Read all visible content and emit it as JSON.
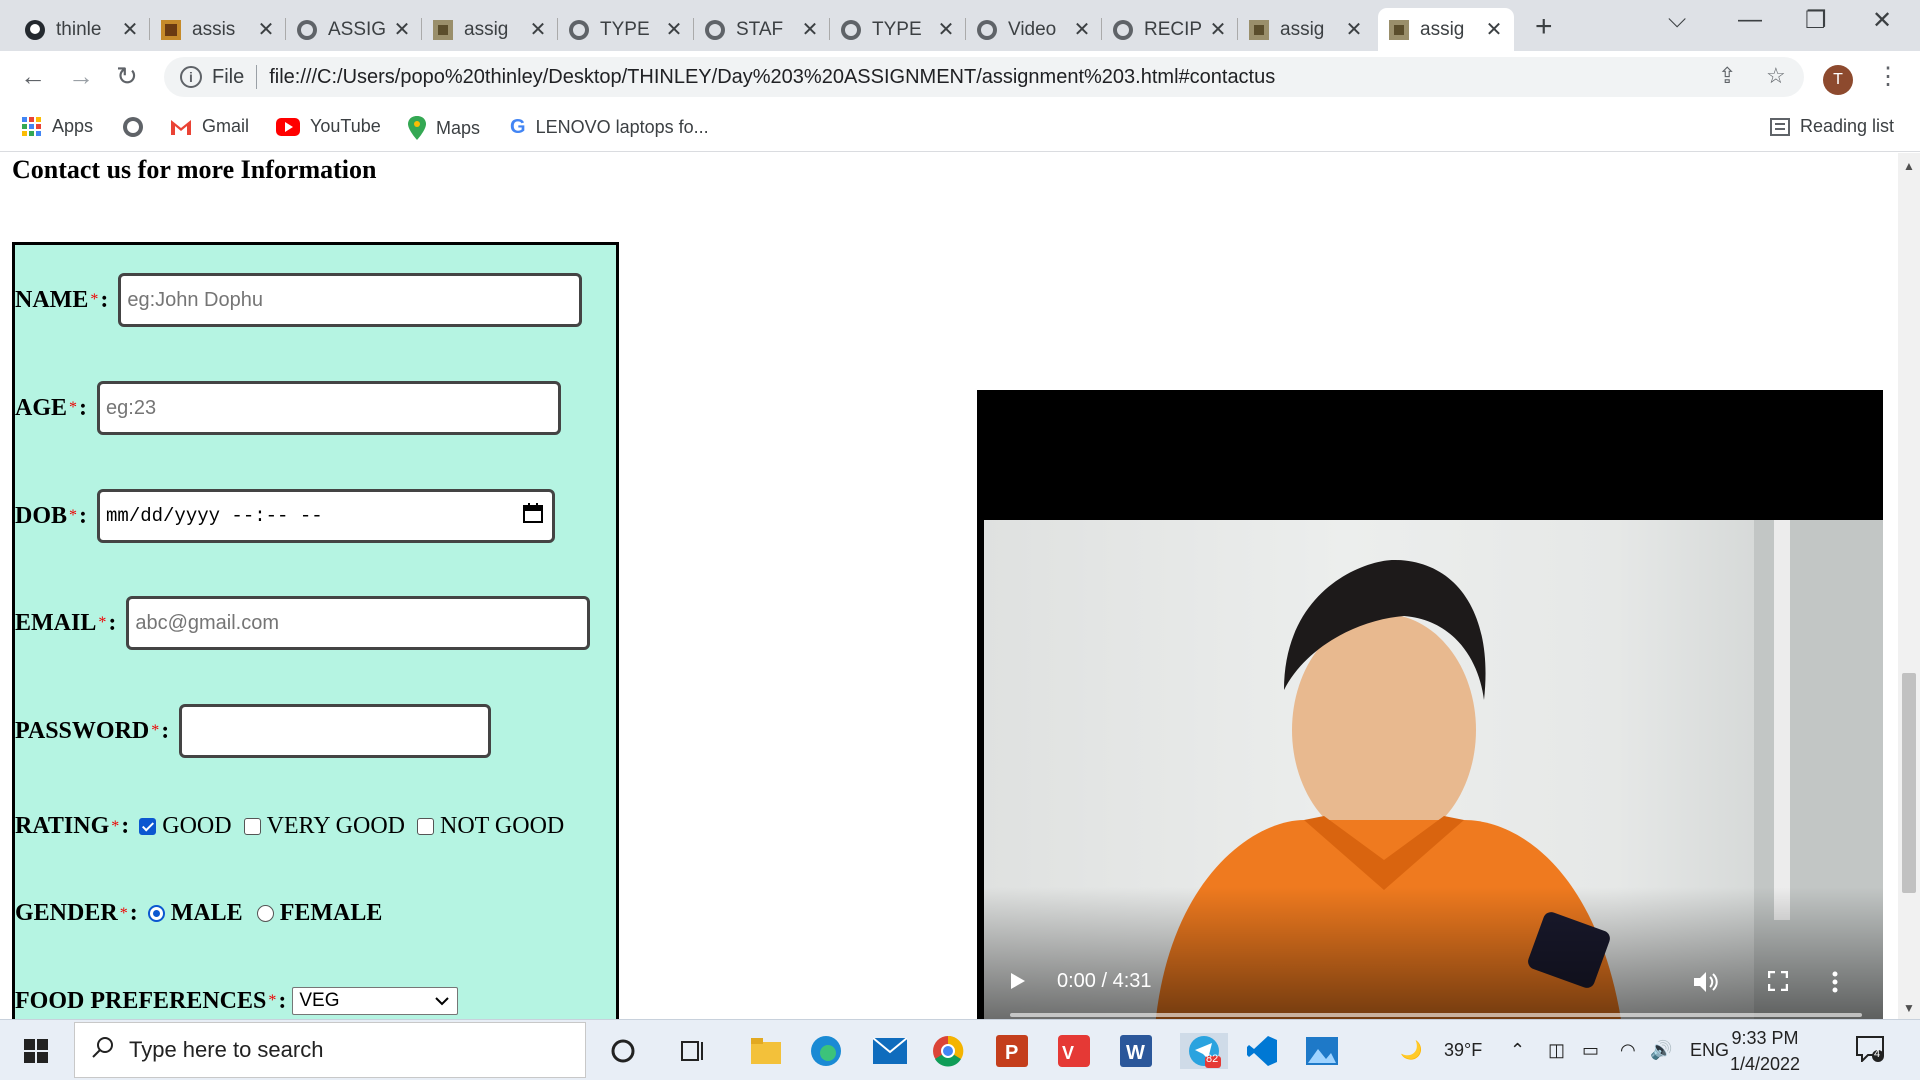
{
  "browser": {
    "tabs": [
      {
        "title": "thinle",
        "icon": "github-icon"
      },
      {
        "title": "assis",
        "icon": "image-icon"
      },
      {
        "title": "ASSIG",
        "icon": "globe-icon"
      },
      {
        "title": "assig",
        "icon": "image-icon"
      },
      {
        "title": "TYPE",
        "icon": "globe-icon"
      },
      {
        "title": "STAF",
        "icon": "globe-icon"
      },
      {
        "title": "TYPE",
        "icon": "globe-icon"
      },
      {
        "title": "Video",
        "icon": "globe-icon"
      },
      {
        "title": "RECIP",
        "icon": "globe-icon"
      },
      {
        "title": "assig",
        "icon": "image-icon"
      },
      {
        "title": "assig",
        "icon": "image-icon",
        "active": true
      }
    ],
    "address": {
      "scheme_label": "File",
      "url": "file:///C:/Users/popo%20thinley/Desktop/THINLEY/Day%203%20ASSIGNMENT/assignment%203.html#contactus"
    },
    "profile_initial": "T",
    "bookmarks": [
      {
        "label": "Apps",
        "icon": "apps-grid-icon"
      },
      {
        "label": "",
        "icon": "globe-icon"
      },
      {
        "label": "Gmail",
        "icon": "gmail-icon"
      },
      {
        "label": "YouTube",
        "icon": "youtube-icon"
      },
      {
        "label": "Maps",
        "icon": "maps-pin-icon"
      },
      {
        "label": "LENOVO laptops fo...",
        "icon": "google-icon"
      }
    ],
    "reading_list": "Reading list"
  },
  "page": {
    "heading": "Contact us for more Information",
    "form": {
      "name_label": "NAME",
      "name_placeholder": "eg:John Dophu",
      "age_label": "AGE",
      "age_placeholder": "eg:23",
      "dob_label": "DOB",
      "dob_placeholder": "mm/dd/yyyy --:-- --",
      "email_label": "EMAIL",
      "email_placeholder": "abc@gmail.com",
      "password_label": "PASSWORD",
      "required_mark": "*",
      "colon": ":",
      "rating_label": "RATING",
      "rating_options": [
        {
          "label": "GOOD",
          "checked": true
        },
        {
          "label": "VERY GOOD",
          "checked": false
        },
        {
          "label": "NOT GOOD",
          "checked": false
        }
      ],
      "gender_label": "GENDER",
      "gender_options": [
        {
          "label": "MALE",
          "selected": true
        },
        {
          "label": "FEMALE",
          "selected": false
        }
      ],
      "food_label": "FOOD PREFERENCES",
      "food_selected": "VEG"
    },
    "video": {
      "time": "0:00 / 4:31",
      "progress_fraction": 0
    }
  },
  "taskbar": {
    "search_placeholder": "Type here to search",
    "weather": "39°F",
    "language": "ENG",
    "time": "9:33 PM",
    "date": "1/4/2022",
    "notifications": "4",
    "telegram_badge": "82"
  },
  "colors": {
    "form_bg": "#b5f4e2",
    "required": "#ee0000",
    "accent": "#0b57d0"
  }
}
